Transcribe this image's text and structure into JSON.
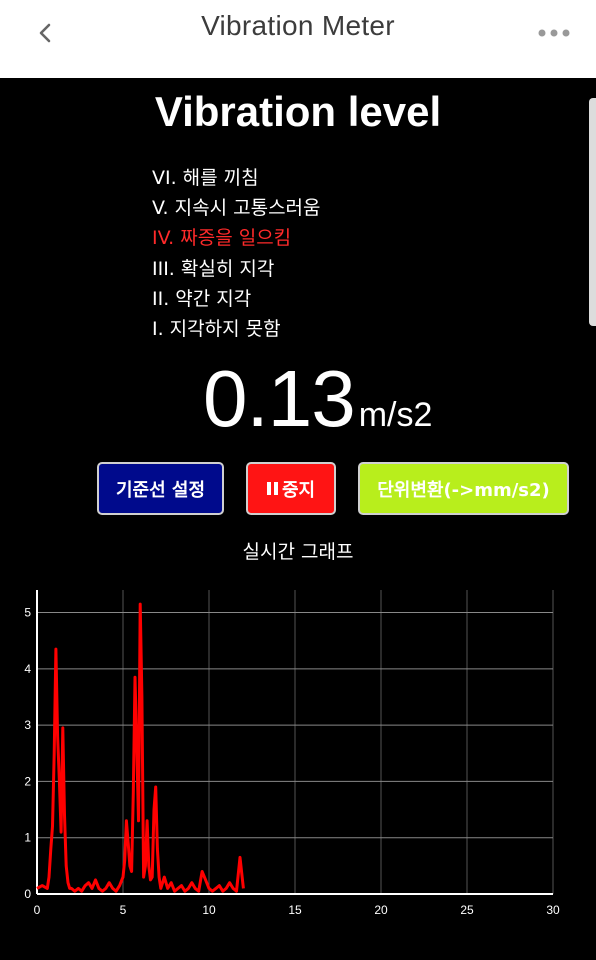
{
  "app_bar": {
    "title": "Vibration Meter",
    "back_icon": "chevron-left-icon",
    "more_icon": "more-horizontal-icon"
  },
  "heading": "Vibration level",
  "levels": [
    {
      "label": "VI. 해를 끼침",
      "active": false
    },
    {
      "label": "V. 지속시 고통스러움",
      "active": false
    },
    {
      "label": "IV. 짜증을 일으킴",
      "active": true
    },
    {
      "label": "III. 확실히 지각",
      "active": false
    },
    {
      "label": "II. 약간 지각",
      "active": false
    },
    {
      "label": "I. 지각하지 못함",
      "active": false
    }
  ],
  "reading": {
    "value": "0.13",
    "unit": "m/s2"
  },
  "buttons": {
    "baseline": "기준선 설정",
    "stop": "중지",
    "stop_icon": "pause-icon",
    "unit_toggle": "단위변환(->mm/s2)"
  },
  "colors": {
    "active_level": "#ff2a2a",
    "baseline_button": "#000a8c",
    "stop_button": "#ff1414",
    "unit_button": "#b8ee1c",
    "series": "#ff0000"
  },
  "graph_title": "실시간 그래프",
  "chart_data": {
    "type": "line",
    "title": "실시간 그래프",
    "xlabel": "",
    "ylabel": "",
    "xlim": [
      0,
      30
    ],
    "ylim": [
      0,
      5.4
    ],
    "x_ticks": [
      0,
      5,
      10,
      15,
      20,
      25,
      30
    ],
    "y_ticks": [
      0,
      1,
      2,
      3,
      4,
      5
    ],
    "grid": true,
    "series": [
      {
        "x": [
          0.0,
          0.3,
          0.6,
          0.7,
          0.8,
          0.9,
          1.0,
          1.1,
          1.2,
          1.3,
          1.4,
          1.5,
          1.6,
          1.7,
          1.8,
          1.9,
          2.0,
          2.2,
          2.4,
          2.6,
          2.8,
          3.0,
          3.2,
          3.4,
          3.6,
          3.8,
          4.0,
          4.2,
          4.4,
          4.6,
          4.8,
          5.0,
          5.1,
          5.2,
          5.3,
          5.4,
          5.5,
          5.6,
          5.7,
          5.8,
          5.9,
          6.0,
          6.1,
          6.2,
          6.3,
          6.4,
          6.5,
          6.6,
          6.7,
          6.8,
          6.9,
          7.0,
          7.1,
          7.2,
          7.3,
          7.4,
          7.6,
          7.8,
          8.0,
          8.2,
          8.4,
          8.6,
          8.8,
          9.0,
          9.2,
          9.4,
          9.6,
          9.8,
          10.0,
          10.2,
          10.4,
          10.6,
          10.8,
          11.0,
          11.2,
          11.4,
          11.6,
          11.8,
          12.0
        ],
        "y": [
          0.1,
          0.15,
          0.1,
          0.3,
          0.8,
          1.2,
          2.5,
          4.35,
          2.8,
          2.0,
          1.1,
          2.95,
          1.4,
          0.5,
          0.2,
          0.1,
          0.1,
          0.05,
          0.1,
          0.05,
          0.15,
          0.2,
          0.1,
          0.25,
          0.1,
          0.05,
          0.1,
          0.2,
          0.1,
          0.05,
          0.15,
          0.3,
          0.6,
          1.3,
          0.9,
          0.5,
          0.4,
          1.8,
          3.85,
          2.6,
          1.3,
          5.15,
          3.5,
          0.3,
          0.5,
          1.3,
          0.5,
          0.25,
          0.3,
          1.5,
          1.9,
          0.8,
          0.3,
          0.1,
          0.2,
          0.3,
          0.1,
          0.2,
          0.05,
          0.1,
          0.15,
          0.05,
          0.1,
          0.2,
          0.1,
          0.05,
          0.4,
          0.25,
          0.1,
          0.05,
          0.1,
          0.15,
          0.05,
          0.1,
          0.2,
          0.1,
          0.05,
          0.65,
          0.1
        ]
      }
    ]
  }
}
